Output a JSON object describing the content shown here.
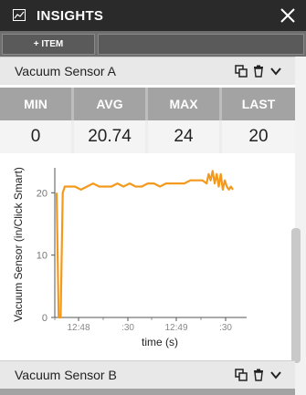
{
  "window": {
    "title": "INSIGHTS",
    "app_icon": "chart-icon",
    "close_icon": "close-icon"
  },
  "toolbar": {
    "add_item_label": "+ ITEM"
  },
  "panels": [
    {
      "name": "Vacuum Sensor A",
      "icons": [
        "copy-icon",
        "trash-icon",
        "chevron-down-icon"
      ],
      "stats": [
        {
          "label": "MIN",
          "value": "0"
        },
        {
          "label": "AVG",
          "value": "20.74"
        },
        {
          "label": "MAX",
          "value": "24"
        },
        {
          "label": "LAST",
          "value": "20"
        }
      ]
    },
    {
      "name": "Vacuum Sensor B",
      "icons": [
        "copy-icon",
        "trash-icon",
        "chevron-down-icon"
      ]
    }
  ],
  "chart_data": {
    "type": "line",
    "xlabel": "time (s)",
    "ylabel": "Vacuum Sensor (in/Click Smart)",
    "ylim": [
      0,
      24
    ],
    "yticks": [
      "0",
      "10",
      "20"
    ],
    "xticks": [
      "12:48",
      ":30",
      "12:49",
      ":30"
    ],
    "line_color": "#f39a1e",
    "series": [
      {
        "values": [
          [
            0,
            20
          ],
          [
            1,
            0
          ],
          [
            2,
            0
          ],
          [
            3,
            20
          ],
          [
            4,
            21
          ],
          [
            6,
            21
          ],
          [
            9,
            21
          ],
          [
            12,
            20.5
          ],
          [
            15,
            21
          ],
          [
            18,
            21.5
          ],
          [
            21,
            21
          ],
          [
            24,
            21
          ],
          [
            27,
            21
          ],
          [
            30,
            21.5
          ],
          [
            33,
            21
          ],
          [
            36,
            21.5
          ],
          [
            39,
            21
          ],
          [
            42,
            21
          ],
          [
            45,
            21.5
          ],
          [
            48,
            21.5
          ],
          [
            51,
            21
          ],
          [
            54,
            21.5
          ],
          [
            57,
            21.5
          ],
          [
            60,
            21.5
          ],
          [
            63,
            21.5
          ],
          [
            66,
            22
          ],
          [
            69,
            22
          ],
          [
            72,
            22
          ],
          [
            74,
            21.5
          ],
          [
            75,
            23
          ],
          [
            76,
            22
          ],
          [
            77,
            23.5
          ],
          [
            78,
            21.5
          ],
          [
            79,
            23
          ],
          [
            80,
            21
          ],
          [
            81,
            23
          ],
          [
            82,
            20.5
          ],
          [
            83,
            22
          ],
          [
            84,
            21
          ],
          [
            85,
            20.5
          ],
          [
            86,
            21
          ],
          [
            87,
            20.5
          ]
        ]
      }
    ]
  }
}
